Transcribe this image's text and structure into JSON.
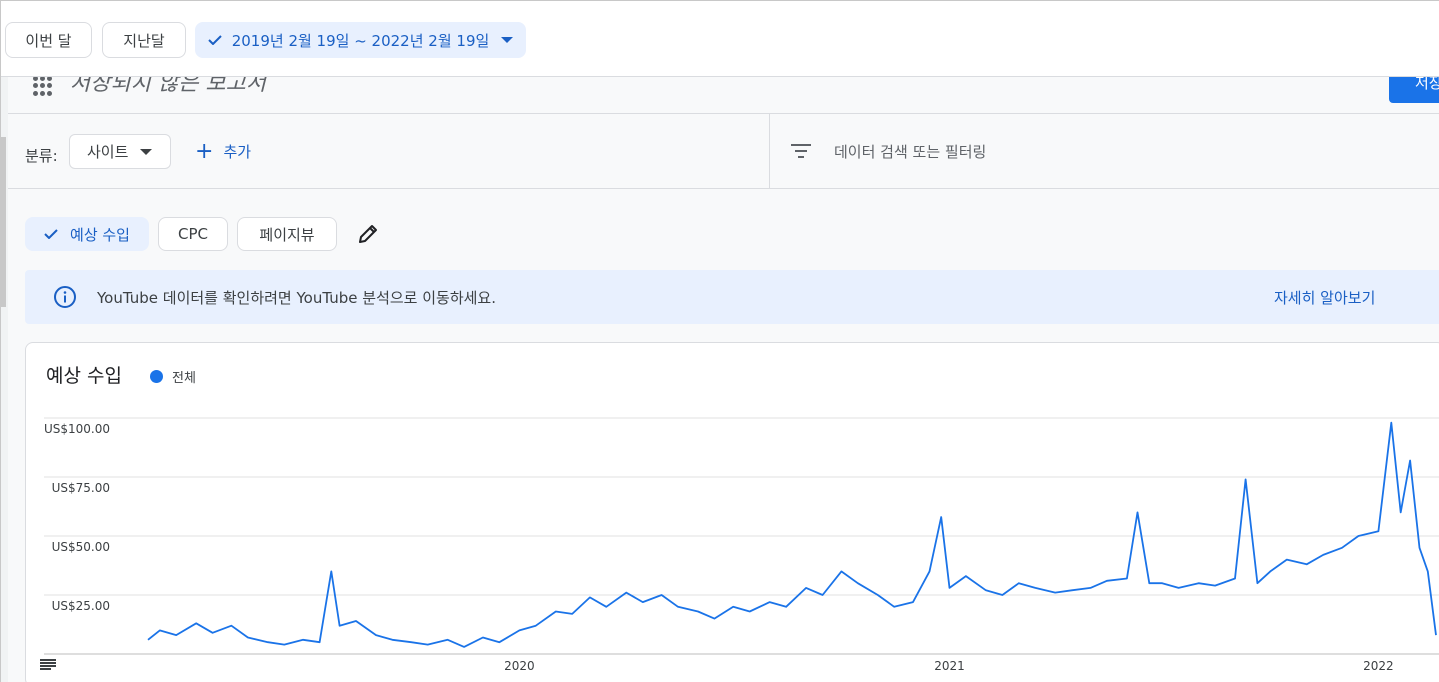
{
  "date_bar": {
    "this_month": "이번 달",
    "last_month": "지난달",
    "date_range": "2019년 2월 19일 ~ 2022년 2월 19일"
  },
  "report": {
    "title": "저장되지 않은 보고서",
    "save_label": "저장"
  },
  "filters": {
    "breakdown_label": "분류:",
    "breakdown_value": "사이트",
    "add_label": "추가",
    "search_placeholder": "데이터 검색 또는 필터링"
  },
  "metrics": [
    {
      "label": "예상 수입",
      "selected": true
    },
    {
      "label": "CPC",
      "selected": false
    },
    {
      "label": "페이지뷰",
      "selected": false
    }
  ],
  "banner": {
    "message": "YouTube 데이터를 확인하려면 YouTube 분석으로 이동하세요.",
    "learn_more": "자세히 알아보기"
  },
  "colors": {
    "accent": "#1a73e8",
    "accent_text": "#1a5fc4",
    "chip_selected_bg": "#e8f0fe"
  },
  "icons": [
    "check-icon",
    "caret-down-icon",
    "apps-grid-icon",
    "plus-icon",
    "filter-icon",
    "pencil-icon",
    "info-icon",
    "table-icon"
  ],
  "chart_data": {
    "type": "line",
    "title": "예상 수입",
    "legend": "전체",
    "x_start": "2019-02-19",
    "x_end": "2022-02-19",
    "x_ticks": [
      "2020",
      "2021",
      "2022"
    ],
    "y_ticks": [
      "US$25.00",
      "US$50.00",
      "US$75.00",
      "US$100.00"
    ],
    "y_tick_values": [
      25,
      50,
      75,
      100
    ],
    "ylim": [
      0,
      100
    ],
    "grid": true,
    "series": [
      {
        "name": "전체",
        "color": "#1a73e8",
        "points": [
          [
            "2019-02-19",
            6
          ],
          [
            "2019-03-01",
            10
          ],
          [
            "2019-03-15",
            8
          ],
          [
            "2019-04-01",
            13
          ],
          [
            "2019-04-15",
            9
          ],
          [
            "2019-05-01",
            12
          ],
          [
            "2019-05-15",
            7
          ],
          [
            "2019-06-01",
            5
          ],
          [
            "2019-06-15",
            4
          ],
          [
            "2019-07-01",
            6
          ],
          [
            "2019-07-15",
            5
          ],
          [
            "2019-07-25",
            35
          ],
          [
            "2019-08-01",
            12
          ],
          [
            "2019-08-15",
            14
          ],
          [
            "2019-09-01",
            8
          ],
          [
            "2019-09-15",
            6
          ],
          [
            "2019-10-01",
            5
          ],
          [
            "2019-10-15",
            4
          ],
          [
            "2019-11-01",
            6
          ],
          [
            "2019-11-15",
            3
          ],
          [
            "2019-12-01",
            7
          ],
          [
            "2019-12-15",
            5
          ],
          [
            "2020-01-01",
            10
          ],
          [
            "2020-01-15",
            12
          ],
          [
            "2020-02-01",
            18
          ],
          [
            "2020-02-15",
            17
          ],
          [
            "2020-03-01",
            24
          ],
          [
            "2020-03-15",
            20
          ],
          [
            "2020-04-01",
            26
          ],
          [
            "2020-04-15",
            22
          ],
          [
            "2020-05-01",
            25
          ],
          [
            "2020-05-15",
            20
          ],
          [
            "2020-06-01",
            18
          ],
          [
            "2020-06-15",
            15
          ],
          [
            "2020-07-01",
            20
          ],
          [
            "2020-07-15",
            18
          ],
          [
            "2020-08-01",
            22
          ],
          [
            "2020-08-15",
            20
          ],
          [
            "2020-09-01",
            28
          ],
          [
            "2020-09-15",
            25
          ],
          [
            "2020-10-01",
            35
          ],
          [
            "2020-10-15",
            30
          ],
          [
            "2020-11-01",
            25
          ],
          [
            "2020-11-15",
            20
          ],
          [
            "2020-12-01",
            22
          ],
          [
            "2020-12-15",
            35
          ],
          [
            "2020-12-25",
            58
          ],
          [
            "2021-01-01",
            28
          ],
          [
            "2021-01-15",
            33
          ],
          [
            "2021-02-01",
            27
          ],
          [
            "2021-02-15",
            25
          ],
          [
            "2021-03-01",
            30
          ],
          [
            "2021-03-15",
            28
          ],
          [
            "2021-04-01",
            26
          ],
          [
            "2021-04-15",
            27
          ],
          [
            "2021-05-01",
            28
          ],
          [
            "2021-05-15",
            31
          ],
          [
            "2021-06-01",
            32
          ],
          [
            "2021-06-10",
            60
          ],
          [
            "2021-06-20",
            30
          ],
          [
            "2021-07-01",
            30
          ],
          [
            "2021-07-15",
            28
          ],
          [
            "2021-08-01",
            30
          ],
          [
            "2021-08-15",
            29
          ],
          [
            "2021-09-01",
            32
          ],
          [
            "2021-09-10",
            74
          ],
          [
            "2021-09-20",
            30
          ],
          [
            "2021-10-01",
            35
          ],
          [
            "2021-10-15",
            40
          ],
          [
            "2021-11-01",
            38
          ],
          [
            "2021-11-15",
            42
          ],
          [
            "2021-12-01",
            45
          ],
          [
            "2021-12-15",
            50
          ],
          [
            "2022-01-01",
            52
          ],
          [
            "2022-01-12",
            98
          ],
          [
            "2022-01-20",
            60
          ],
          [
            "2022-01-28",
            82
          ],
          [
            "2022-02-05",
            45
          ],
          [
            "2022-02-12",
            35
          ],
          [
            "2022-02-19",
            8
          ]
        ]
      }
    ]
  }
}
